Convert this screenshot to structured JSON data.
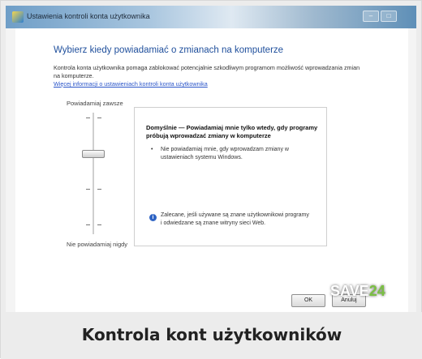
{
  "window": {
    "title": "Ustawienia kontroli konta użytkownika"
  },
  "main": {
    "heading": "Wybierz kiedy powiadamiać o zmianach na komputerze",
    "description": "Kontrola konta użytkownika pomaga zablokować potencjalnie szkodliwym programom możliwość wprowadzania zmian na komputerze.",
    "link": "Więcej informacji o ustawieniach kontroli konta użytkownika"
  },
  "slider": {
    "top_label": "Powiadamiaj zawsze",
    "bottom_label": "Nie powiadamiaj nigdy",
    "level": 2,
    "levels": 4
  },
  "info": {
    "title": "Domyślnie — Powiadamiaj mnie tylko wtedy, gdy programy próbują wprowadzać zmiany w komputerze",
    "bullet": "Nie powiadamiaj mnie, gdy wprowadzam zmiany w ustawieniach systemu Windows.",
    "note": "Zalecane, jeśli używane są znane użytkownikowi programy i odwiedzane są znane witryny sieci Web."
  },
  "buttons": {
    "ok": "OK",
    "cancel": "Anuluj"
  },
  "watermark": {
    "text": "SAVE",
    "accent": "24"
  },
  "caption": {
    "text": "Kontrola kont użytkowników"
  },
  "colors": {
    "heading": "#1f4f9c",
    "link": "#2a55c9"
  }
}
